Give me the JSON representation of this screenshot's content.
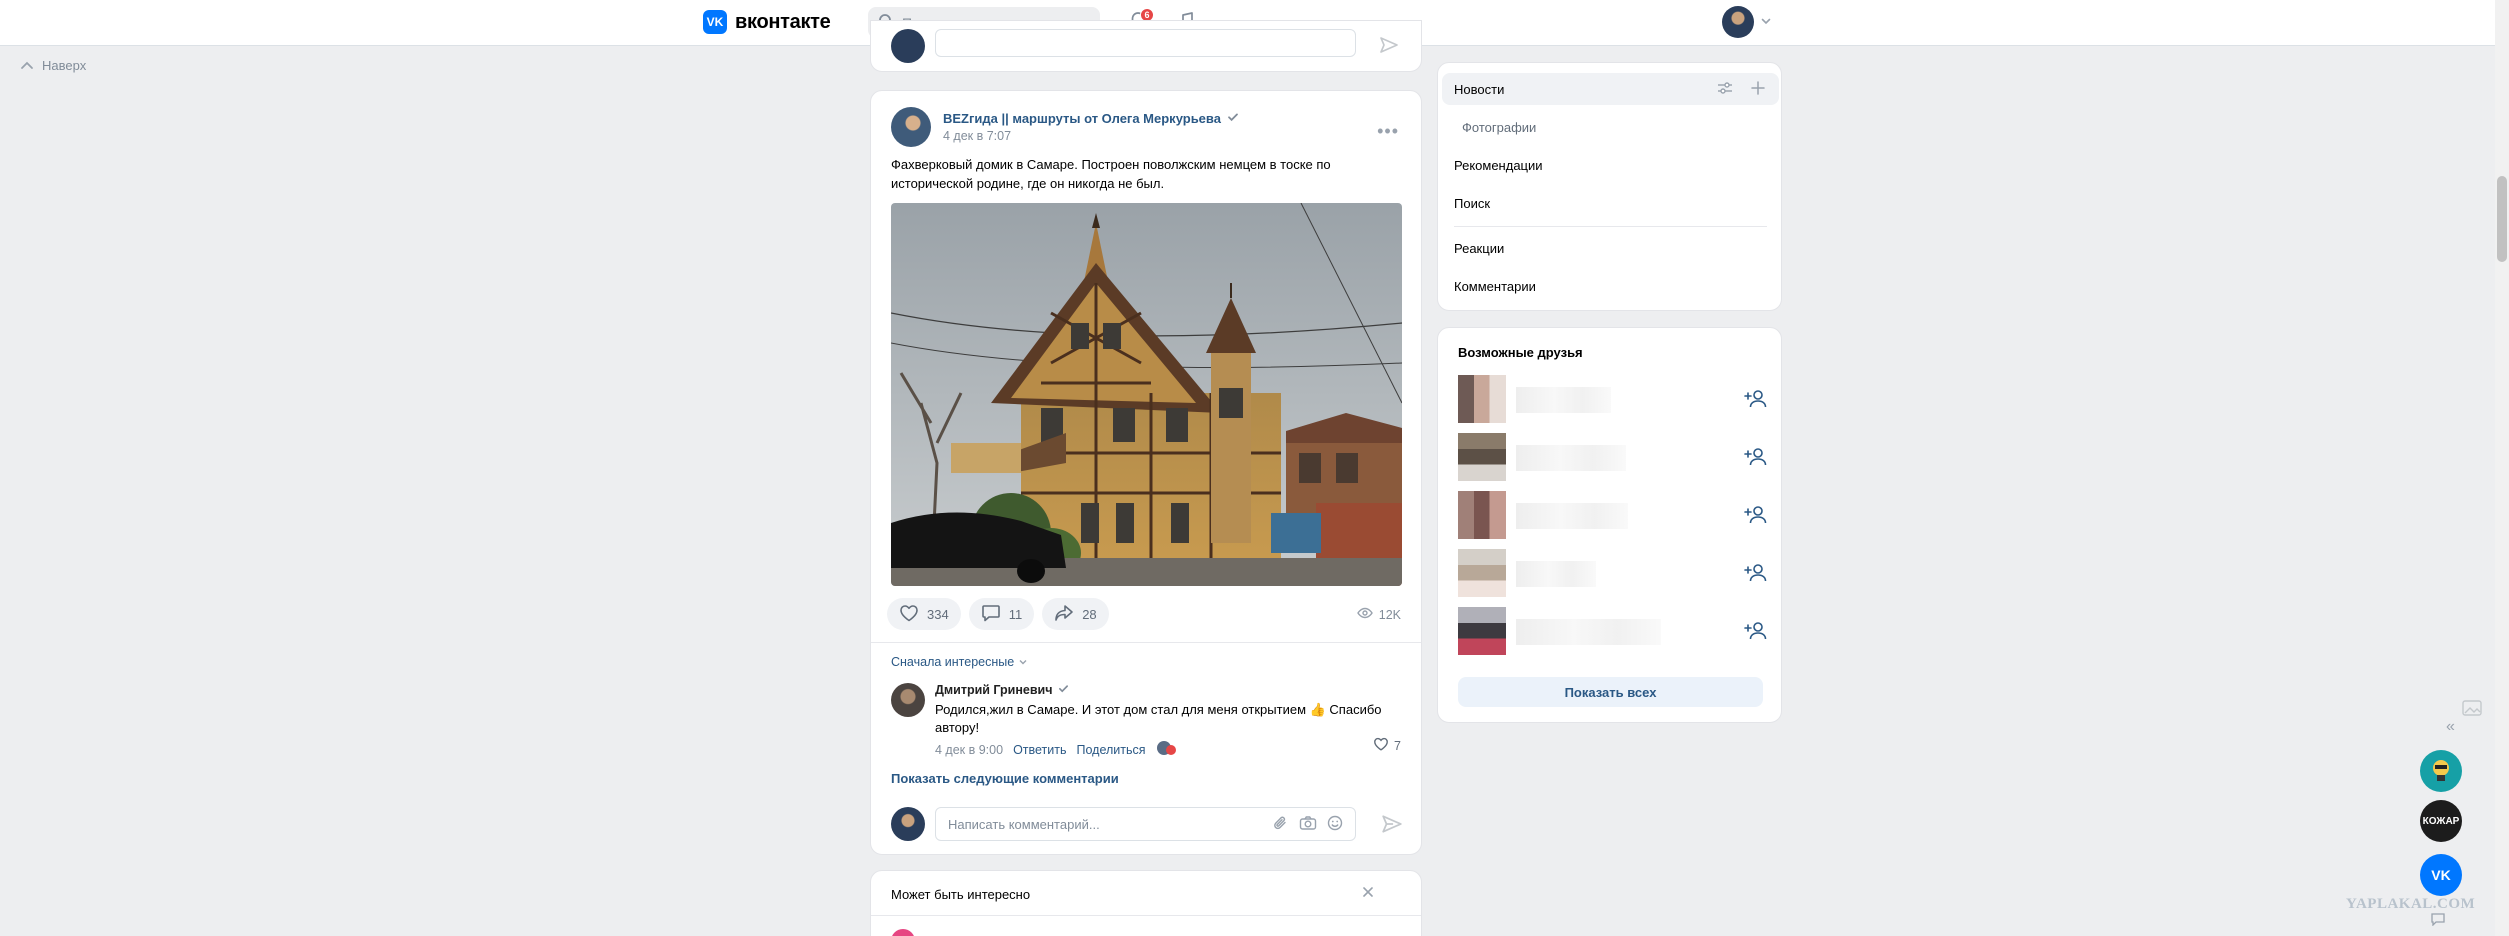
{
  "header": {
    "logo_text": "вконтакте",
    "search_placeholder": "Поиск",
    "notifications_count": "6"
  },
  "back_to_top": "Наверх",
  "post": {
    "author": "BEZгида || маршруты от Олега Меркурьева",
    "date": "4 дек в 7:07",
    "text": "Фахверковый домик в Самаре. Построен поволжским немцем в тоске по исторической родине, где он никогда не был.",
    "likes": "334",
    "comments": "11",
    "shares": "28",
    "views": "12K",
    "sort_label": "Сначала интересные",
    "comment": {
      "author": "Дмитрий Гриневич",
      "text": "Родился,жил в Самаре. И этот дом стал для меня открытием 👍 Спасибо автору!",
      "date": "4 дек в 9:00",
      "reply": "Ответить",
      "share": "Поделиться",
      "likes": "7"
    },
    "more_comments": "Показать следующие комментарии",
    "write_placeholder": "Написать комментарий..."
  },
  "maybe_interesting": {
    "title": "Может быть интересно"
  },
  "nav": {
    "items": [
      "Новости",
      "Фотографии",
      "Рекомендации",
      "Поиск",
      "Реакции",
      "Комментарии"
    ]
  },
  "friends": {
    "title": "Возможные друзья",
    "show_all": "Показать всех"
  },
  "dock": {
    "app2_label": "КОЖАР"
  },
  "watermark": "YAPLAKAL.COM",
  "colors": {
    "accent": "#0077ff",
    "link": "#2a5885",
    "background": "#edeef0",
    "badge": "#e64646"
  }
}
